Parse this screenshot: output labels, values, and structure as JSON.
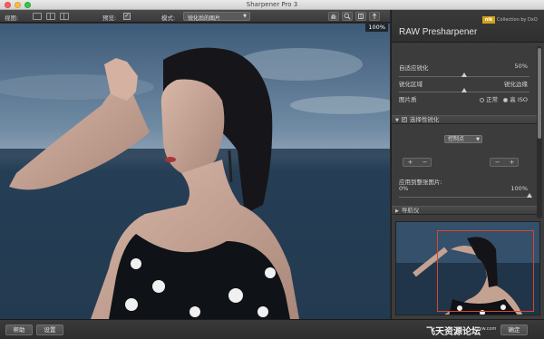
{
  "window": {
    "title": "Sharpener Pro 3"
  },
  "toolbar": {
    "view_label": "视图:",
    "preview_label": "预览:",
    "preview_checked": "✓",
    "mode_label": "模式:",
    "mode_value": "锐化后的图片",
    "tools": [
      "hand-tool-icon",
      "zoom-tool-icon",
      "magnifier-tool-icon",
      "pin-tool-icon"
    ]
  },
  "canvas": {
    "zoom": "100%"
  },
  "panel": {
    "brand_badge": "nik",
    "brand_text": "Collection by DxO",
    "title": "RAW Presharpener",
    "adaptive_label": "自适应锐化",
    "adaptive_value": "50%",
    "adaptive_level": 0.5,
    "range_left": "锐化区域",
    "range_right": "锐化边缘",
    "range_level": 0.5,
    "image_type_label": "图片质",
    "image_type_options": [
      "正常",
      "高 ISO"
    ],
    "image_type_selected": "高 ISO",
    "selective_section": "选择性锐化",
    "selective_checked": "✓",
    "control_point_select": "控制点",
    "plus_label": "+",
    "minus_label": "−",
    "apply_label": "应用到整张图片:",
    "apply_min": "0%",
    "apply_max": "100%",
    "apply_level": 1.0,
    "navigator_section": "导航仪"
  },
  "bottom": {
    "help": "帮助",
    "settings": "设置",
    "ok": "确定",
    "watermark": "飞天资源论坛",
    "watermark_url": "ttzyw.com"
  },
  "colors": {
    "accent": "#d9442e",
    "brand": "#d4a019"
  }
}
